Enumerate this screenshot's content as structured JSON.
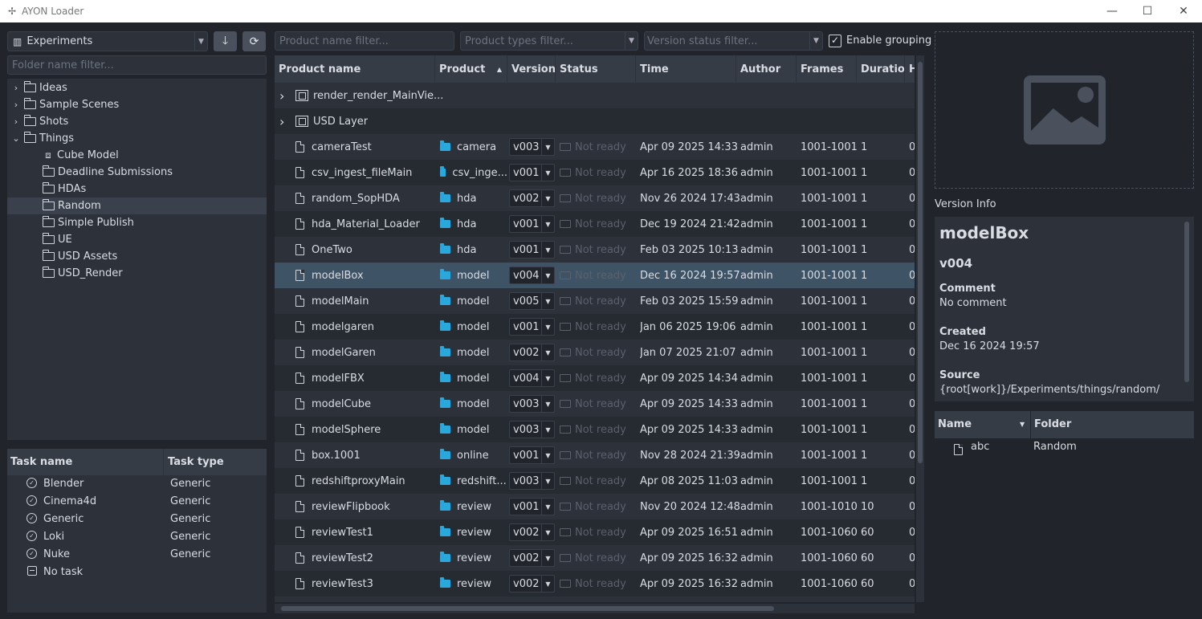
{
  "window": {
    "title": "AYON Loader",
    "minimize": "—",
    "maximize": "☐",
    "close": "✕"
  },
  "project": {
    "selected": "Experiments"
  },
  "folder_filter": {
    "placeholder": "Folder name filter..."
  },
  "folders": [
    {
      "label": "Ideas",
      "expander": "›",
      "icon": "folder-icon"
    },
    {
      "label": "Sample Scenes",
      "expander": "›",
      "icon": "folder-icon"
    },
    {
      "label": "Shots",
      "expander": "›",
      "icon": "folder-icon"
    },
    {
      "label": "Things",
      "expander": "⌄",
      "icon": "folder-icon"
    },
    {
      "label": "Cube Model",
      "icon": "cube-icon"
    },
    {
      "label": "Deadline Submissions",
      "icon": "folder-icon"
    },
    {
      "label": "HDAs",
      "icon": "folder-icon"
    },
    {
      "label": "Random",
      "icon": "folder-icon",
      "selected": true
    },
    {
      "label": "Simple Publish",
      "icon": "folder-icon"
    },
    {
      "label": "UE",
      "icon": "folder-icon"
    },
    {
      "label": "USD Assets",
      "icon": "folder-icon"
    },
    {
      "label": "USD_Render",
      "icon": "folder-icon"
    }
  ],
  "tasks": {
    "headers": {
      "name": "Task name",
      "type": "Task type"
    },
    "rows": [
      {
        "name": "Blender",
        "type": "Generic"
      },
      {
        "name": "Cinema4d",
        "type": "Generic"
      },
      {
        "name": "Generic",
        "type": "Generic"
      },
      {
        "name": "Loki",
        "type": "Generic"
      },
      {
        "name": "Nuke",
        "type": "Generic"
      },
      {
        "name": "No task",
        "type": ""
      }
    ]
  },
  "filters": {
    "product_name": "Product name filter...",
    "product_types": "Product types filter...",
    "version_status": "Version status filter...",
    "enable_grouping": "Enable grouping",
    "enable_grouping_checked": true
  },
  "products": {
    "headers": [
      "Product name",
      "Product",
      "Version",
      "Status",
      "Time",
      "Author",
      "Frames",
      "Duratio",
      "H"
    ],
    "groups": [
      {
        "name": "render_render_MainVie..."
      },
      {
        "name": "USD Layer"
      }
    ],
    "rows": [
      {
        "name": "cameraTest",
        "type": "camera",
        "version": "v003",
        "status": "Not ready",
        "time": "Apr 09 2025 14:33",
        "author": "admin",
        "frames": "1001-1001",
        "duration": "1",
        "h": "0"
      },
      {
        "name": "csv_ingest_fileMain",
        "type": "csv_inge...",
        "version": "v001",
        "status": "Not ready",
        "time": "Apr 16 2025 18:36",
        "author": "admin",
        "frames": "1001-1001",
        "duration": "1",
        "h": "0"
      },
      {
        "name": "random_SopHDA",
        "type": "hda",
        "version": "v002",
        "status": "Not ready",
        "time": "Nov 26 2024 17:43",
        "author": "admin",
        "frames": "1001-1001",
        "duration": "1",
        "h": "0"
      },
      {
        "name": "hda_Material_Loader",
        "type": "hda",
        "version": "v001",
        "status": "Not ready",
        "time": "Dec 19 2024 21:42",
        "author": "admin",
        "frames": "1001-1001",
        "duration": "1",
        "h": "0"
      },
      {
        "name": "OneTwo",
        "type": "hda",
        "version": "v001",
        "status": "Not ready",
        "time": "Feb 03 2025 10:13",
        "author": "admin",
        "frames": "1001-1001",
        "duration": "1",
        "h": "0"
      },
      {
        "name": "modelBox",
        "type": "model",
        "version": "v004",
        "status": "Not ready",
        "time": "Dec 16 2024 19:57",
        "author": "admin",
        "frames": "1001-1001",
        "duration": "1",
        "h": "0",
        "selected": true
      },
      {
        "name": "modelMain",
        "type": "model",
        "version": "v005",
        "status": "Not ready",
        "time": "Feb 03 2025 15:59",
        "author": "admin",
        "frames": "1001-1001",
        "duration": "1",
        "h": "0"
      },
      {
        "name": "modelgaren",
        "type": "model",
        "version": "v001",
        "status": "Not ready",
        "time": "Jan 06 2025 19:06",
        "author": "admin",
        "frames": "1001-1001",
        "duration": "1",
        "h": "0"
      },
      {
        "name": "modelGaren",
        "type": "model",
        "version": "v002",
        "status": "Not ready",
        "time": "Jan 07 2025 21:07",
        "author": "admin",
        "frames": "1001-1001",
        "duration": "1",
        "h": "0"
      },
      {
        "name": "modelFBX",
        "type": "model",
        "version": "v004",
        "status": "Not ready",
        "time": "Apr 09 2025 14:34",
        "author": "admin",
        "frames": "1001-1001",
        "duration": "1",
        "h": "0"
      },
      {
        "name": "modelCube",
        "type": "model",
        "version": "v003",
        "status": "Not ready",
        "time": "Apr 09 2025 14:33",
        "author": "admin",
        "frames": "1001-1001",
        "duration": "1",
        "h": "0"
      },
      {
        "name": "modelSphere",
        "type": "model",
        "version": "v003",
        "status": "Not ready",
        "time": "Apr 09 2025 14:33",
        "author": "admin",
        "frames": "1001-1001",
        "duration": "1",
        "h": "0"
      },
      {
        "name": "box.1001",
        "type": "online",
        "version": "v001",
        "status": "Not ready",
        "time": "Nov 28 2024 21:39",
        "author": "admin",
        "frames": "1001-1001",
        "duration": "1",
        "h": "0"
      },
      {
        "name": "redshiftproxyMain",
        "type": "redshift...",
        "version": "v003",
        "status": "Not ready",
        "time": "Apr 08 2025 11:03",
        "author": "admin",
        "frames": "1001-1001",
        "duration": "1",
        "h": "0"
      },
      {
        "name": "reviewFlipbook",
        "type": "review",
        "version": "v001",
        "status": "Not ready",
        "time": "Nov 20 2024 12:48",
        "author": "admin",
        "frames": "1001-1010",
        "duration": "10",
        "h": "0"
      },
      {
        "name": "reviewTest1",
        "type": "review",
        "version": "v002",
        "status": "Not ready",
        "time": "Apr 09 2025 16:51",
        "author": "admin",
        "frames": "1001-1060",
        "duration": "60",
        "h": "0"
      },
      {
        "name": "reviewTest2",
        "type": "review",
        "version": "v002",
        "status": "Not ready",
        "time": "Apr 09 2025 16:32",
        "author": "admin",
        "frames": "1001-1060",
        "duration": "60",
        "h": "0"
      },
      {
        "name": "reviewTest3",
        "type": "review",
        "version": "v002",
        "status": "Not ready",
        "time": "Apr 09 2025 16:32",
        "author": "admin",
        "frames": "1001-1060",
        "duration": "60",
        "h": "0"
      }
    ]
  },
  "version_info": {
    "label": "Version Info",
    "product": "modelBox",
    "version": "v004",
    "comment_label": "Comment",
    "comment": "No comment",
    "created_label": "Created",
    "created": "Dec 16 2024 19:57",
    "source_label": "Source",
    "source": "{root[work]}/Experiments/things/random/"
  },
  "representations": {
    "headers": {
      "name": "Name",
      "folder": "Folder"
    },
    "rows": [
      {
        "name": "abc",
        "folder": "Random"
      }
    ]
  }
}
